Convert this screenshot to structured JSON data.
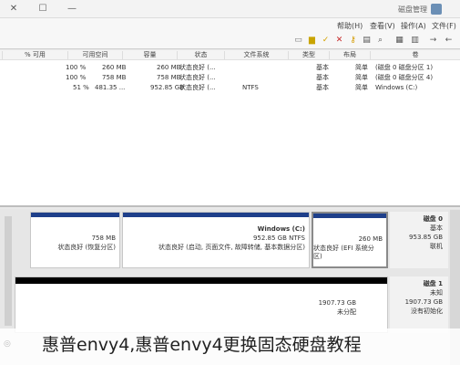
{
  "window": {
    "title": "磁盘管理"
  },
  "menu": [
    "文件(F)",
    "操作(A)",
    "查看(V)",
    "帮助(H)"
  ],
  "toolbar_icons": [
    "back-icon",
    "forward-icon",
    "list-view-icon",
    "help-icon",
    "properties-icon",
    "key-icon",
    "delete-icon",
    "check-icon",
    "folder-icon",
    "search-icon",
    "console-icon"
  ],
  "table": {
    "headers": [
      "卷",
      "布局",
      "类型",
      "文件系统",
      "状态",
      "容量",
      "可用空间",
      "% 可用"
    ],
    "rows": [
      [
        "(磁盘 0 磁盘分区 1)",
        "简单",
        "基本",
        "",
        "状态良好 (...",
        "260 MB",
        "260 MB",
        "100 %"
      ],
      [
        "(磁盘 0 磁盘分区 4)",
        "简单",
        "基本",
        "",
        "状态良好 (...",
        "758 MB",
        "758 MB",
        "100 %"
      ],
      [
        "Windows (C:)",
        "简单",
        "基本",
        "NTFS",
        "状态良好 (...",
        "952.85 GB",
        "481.35 ...",
        "51 %"
      ]
    ]
  },
  "disk0": {
    "name": "磁盘 0",
    "type": "基本",
    "size": "953.85 GB",
    "status": "联机",
    "partitions": [
      {
        "name": "",
        "size": "260 MB",
        "status": "状态良好 (EFI 系统分区)"
      },
      {
        "name": "Windows (C:)",
        "size": "952.85 GB NTFS",
        "status": "状态良好 (启动, 页面文件, 故障转储, 基本数据分区)"
      },
      {
        "name": "",
        "size": "758 MB",
        "status": "状态良好 (恢复分区)"
      }
    ]
  },
  "disk1": {
    "name": "磁盘 1",
    "type": "未知",
    "size": "1907.73 GB",
    "status": "没有初始化",
    "unallocated_size": "1907.73 GB",
    "unallocated_label": "未分配"
  },
  "caption": "惠普envy4,惠普envy4更换固态硬盘教程",
  "colors": {
    "partition_bar": "#1e3f8a",
    "unallocated_bar": "#000000"
  }
}
